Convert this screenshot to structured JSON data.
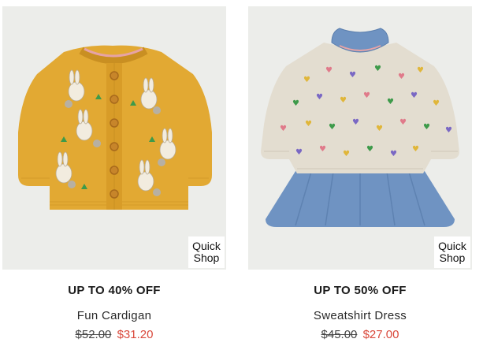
{
  "products": [
    {
      "promo": "UP TO 40% OFF",
      "name": "Fun Cardigan",
      "old_price": "$52.00",
      "new_price": "$31.20",
      "quick_shop_line1": "Quick",
      "quick_shop_line2": "Shop",
      "image": "yellow-bunny-cardigan-image"
    },
    {
      "promo": "UP TO 50% OFF",
      "name": "Sweatshirt Dress",
      "old_price": "$45.00",
      "new_price": "$27.00",
      "quick_shop_line1": "Quick",
      "quick_shop_line2": "Shop",
      "image": "heart-sweatshirt-dress-image"
    }
  ],
  "colors": {
    "sale_price": "#d9483b",
    "cardigan_yellow": "#e2a933",
    "dress_denim": "#6f93c2",
    "sweatshirt_oatmeal": "#e3ddd0"
  }
}
